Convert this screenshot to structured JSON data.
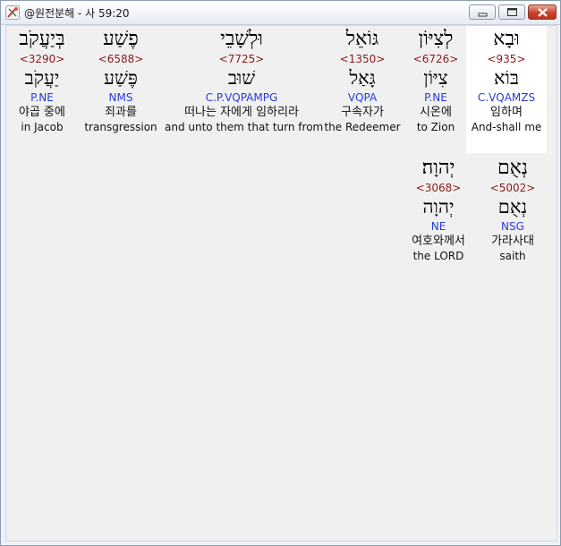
{
  "window": {
    "title": "@원전분해 - 사 59:20",
    "minimize_icon": "minimize-icon",
    "maximize_icon": "maximize-icon",
    "close_icon": "close-icon",
    "app_icon": "tools-icon"
  },
  "row1": [
    {
      "hebrew": "וּבָא",
      "strong": "<935>",
      "lemma": "בּוֹא",
      "morph": "C.VQAMZS",
      "korean": "임하며",
      "english": "And-shall me",
      "selected": true
    },
    {
      "hebrew": "לְצִיּוֹן",
      "strong": "<6726>",
      "lemma": "צִיּוֹן",
      "morph": "P.NE",
      "korean": "시온에",
      "english": "to Zion"
    },
    {
      "hebrew": "גּוֹאֵל",
      "strong": "<1350>",
      "lemma": "גָּאַל",
      "morph": "VQPA",
      "korean": "구속자가",
      "english": "the Redeemer"
    },
    {
      "hebrew": "וּלְשָׁבֵי",
      "strong": "<7725>",
      "lemma": "שׁוּב",
      "morph": "C.P.VQPAMPG",
      "korean": "떠나는 자에게 임하리라",
      "english": "and unto them that turn from"
    },
    {
      "hebrew": "פֶשַׁע",
      "strong": "<6588>",
      "lemma": "פֶּשַׁע",
      "morph": "NMS",
      "korean": "죄과를",
      "english": "transgression"
    },
    {
      "hebrew": "בְּיַעֲקֹב",
      "strong": "<3290>",
      "lemma": "יַעֲקֹב",
      "morph": "P.NE",
      "korean": "야곱 중에",
      "english": "in Jacob"
    }
  ],
  "row2": [
    {
      "hebrew": "נְאֻם",
      "strong": "<5002>",
      "lemma": "נְאֻם",
      "morph": "NSG",
      "korean": "가라사대",
      "english": "saith"
    },
    {
      "hebrew": "יְהוָה׃",
      "strong": "<3068>",
      "lemma": "יְהוָה",
      "morph": "NE",
      "korean": "여호와께서",
      "english": "the LORD"
    }
  ]
}
